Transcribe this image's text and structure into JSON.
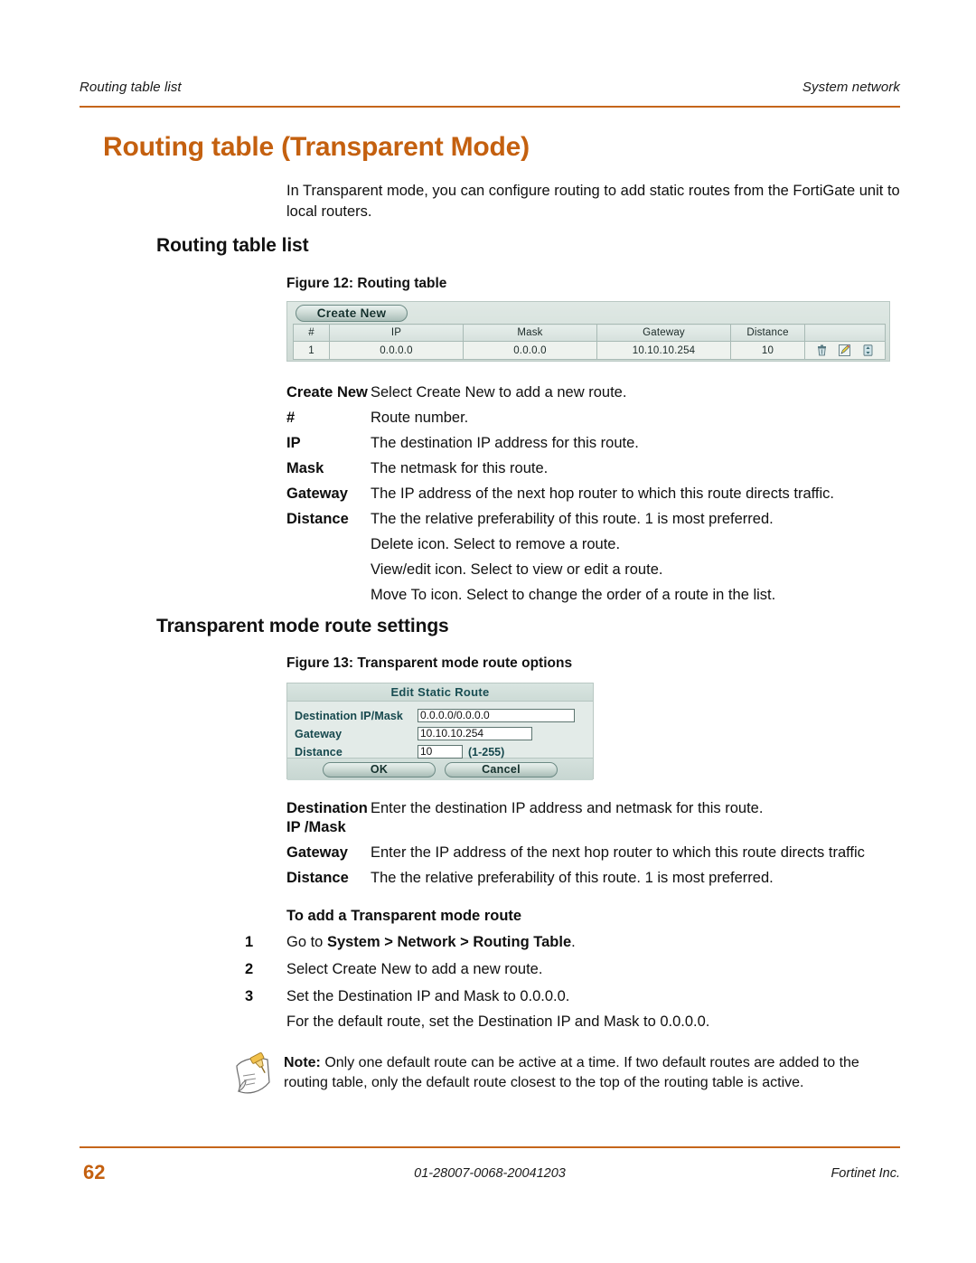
{
  "header": {
    "left": "Routing table list",
    "right": "System network"
  },
  "chapter_title": "Routing table (Transparent Mode)",
  "intro": "In Transparent mode, you can configure routing to add static routes from the FortiGate unit to local routers.",
  "sections": {
    "routing_table_list": "Routing table list",
    "transparent_mode_route_settings": "Transparent mode route settings"
  },
  "figures": {
    "fig12_caption": "Figure 12: Routing table",
    "fig13_caption": "Figure 13: Transparent mode route options"
  },
  "routing_table": {
    "create_new_label": "Create New",
    "columns": [
      "#",
      "IP",
      "Mask",
      "Gateway",
      "Distance",
      ""
    ],
    "rows": [
      {
        "num": "1",
        "ip": "0.0.0.0",
        "mask": "0.0.0.0",
        "gateway": "10.10.10.254",
        "distance": "10"
      }
    ],
    "row_action_icons": [
      "delete-icon",
      "edit-icon",
      "move-to-icon"
    ]
  },
  "table_field_defs": [
    {
      "term": "Create New",
      "desc": "Select Create New to add a new route."
    },
    {
      "term": "#",
      "desc": "Route number."
    },
    {
      "term": "IP",
      "desc": "The destination IP address for this route."
    },
    {
      "term": "Mask",
      "desc": "The netmask for this route."
    },
    {
      "term": "Gateway",
      "desc": "The IP address of the next hop router to which this route directs traffic."
    },
    {
      "term": "Distance",
      "desc": "The the relative preferability of this route. 1 is most preferred."
    },
    {
      "term": "",
      "desc": "Delete icon. Select to remove a route."
    },
    {
      "term": "",
      "desc": "View/edit icon. Select to view or edit a route."
    },
    {
      "term": "",
      "desc": "Move To icon. Select to change the order of a route in the list."
    }
  ],
  "edit_static_route_dialog": {
    "title": "Edit Static Route",
    "fields": {
      "destination_label": "Destination IP/Mask",
      "destination_value": "0.0.0.0/0.0.0.0",
      "gateway_label": "Gateway",
      "gateway_value": "10.10.10.254",
      "distance_label": "Distance",
      "distance_value": "10",
      "distance_hint": "(1-255)"
    },
    "ok_label": "OK",
    "cancel_label": "Cancel"
  },
  "settings_field_defs": [
    {
      "term": "Destination IP /Mask",
      "desc": "Enter the destination IP address and netmask for this route."
    },
    {
      "term": "Gateway",
      "desc": "Enter the IP address of the next hop router to which this route directs traffic"
    },
    {
      "term": "Distance",
      "desc": "The the relative preferability of this route. 1 is most preferred."
    }
  ],
  "procedure": {
    "title": "To add a Transparent mode route",
    "steps": [
      {
        "num": "1",
        "pre": "Go to ",
        "bold": "System > Network > Routing Table",
        "post": "."
      },
      {
        "num": "2",
        "pre": "Select Create New to add a new route.",
        "bold": "",
        "post": ""
      },
      {
        "num": "3",
        "pre": "Set the Destination IP and Mask to 0.0.0.0.",
        "bold": "",
        "post": ""
      }
    ],
    "step3_sub": "For the default route, set the Destination IP and Mask to 0.0.0.0."
  },
  "note": {
    "label": "Note:",
    "text": " Only one default route can be active at a time. If two default routes are added to the routing table, only the default route closest to the top of the routing table is active."
  },
  "footer": {
    "page_number": "62",
    "doc_id": "01-28007-0068-20041203",
    "company": "Fortinet Inc."
  },
  "colors": {
    "accent_orange": "#C4600F",
    "rule_orange": "#C5651A",
    "ui_panel": "#dfe8e4",
    "ui_label_teal": "#17494e"
  }
}
